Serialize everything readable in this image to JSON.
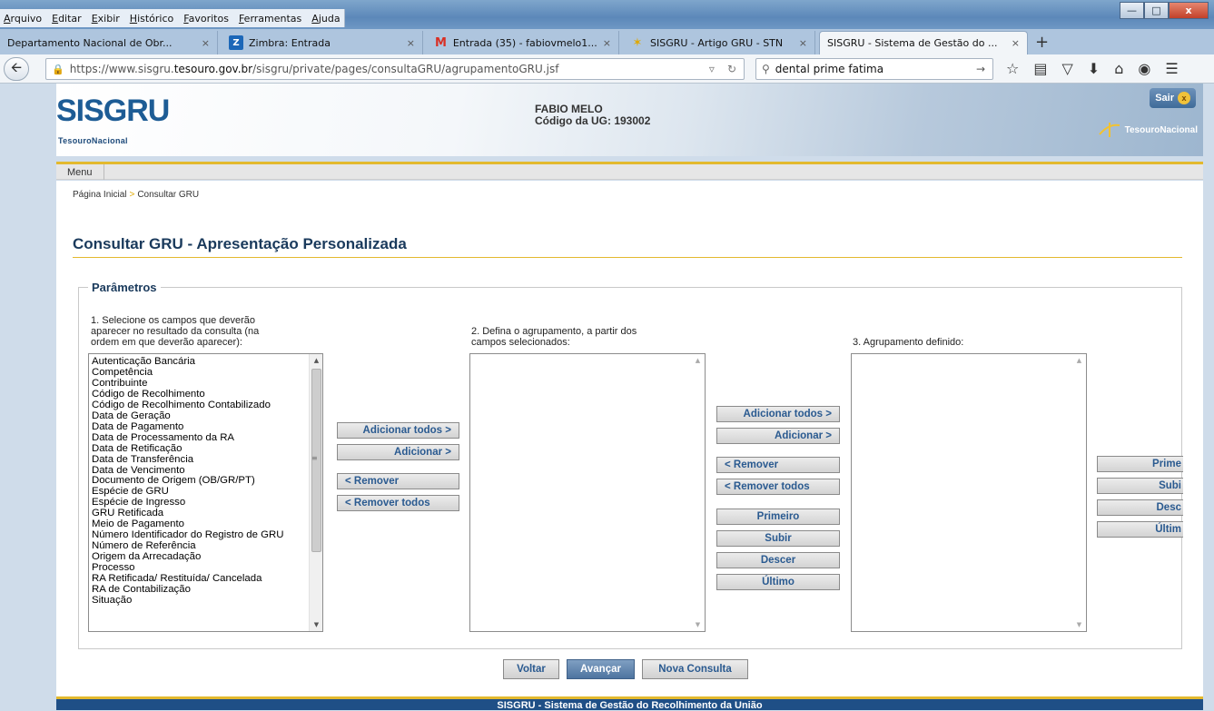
{
  "browser": {
    "menu": [
      "Arquivo",
      "Editar",
      "Exibir",
      "Histórico",
      "Favoritos",
      "Ferramentas",
      "Ajuda"
    ],
    "window_buttons": {
      "minimize": "—",
      "maximize": "□",
      "close": "x"
    },
    "tabs": [
      {
        "title": "Departamento Nacional de Obr...",
        "favicon": ""
      },
      {
        "title": "Zimbra: Entrada",
        "favicon": "Z"
      },
      {
        "title": "Entrada (35) - fabiovmelo1...",
        "favicon": "M"
      },
      {
        "title": "SISGRU - Artigo GRU - STN",
        "favicon": "✶"
      },
      {
        "title": "SISGRU - Sistema de Gestão do ...",
        "favicon": ""
      }
    ],
    "tab_close": "×",
    "new_tab": "+",
    "url_prefix": "https://www.sisgru.",
    "url_domain": "tesouro.gov.br",
    "url_path": "/sisgru/private/pages/consultaGRU/agrupamentoGRU.jsf",
    "search_value": "dental prime fatima"
  },
  "header": {
    "logo": "SISGRU",
    "logo_sub": "TesouroNacional",
    "user_name": "FABIO MELO",
    "ug_code": "Código da UG: 193002",
    "logout_label": "Sair",
    "brand_right": "TesouroNacional"
  },
  "nav": {
    "menu_label": "Menu",
    "breadcrumb_home": "Página Inicial",
    "breadcrumb_sep": ">",
    "breadcrumb_current": "Consultar GRU"
  },
  "page_title": "Consultar GRU - Apresentação Personalizada",
  "params": {
    "legend": "Parâmetros",
    "step1": [
      "1. Selecione os campos que deverão",
      "aparecer no resultado da consulta (na",
      "ordem em que deverão aparecer):"
    ],
    "step2": [
      "2. Defina o agrupamento, a partir dos",
      "campos selecionados:"
    ],
    "step3": "3. Agrupamento definido:",
    "fields": [
      "Autenticação Bancária",
      "Competência",
      "Contribuinte",
      "Código de Recolhimento",
      "Código de Recolhimento Contabilizado",
      "Data de Geração",
      "Data de Pagamento",
      "Data de Processamento da RA",
      "Data de Retificação",
      "Data de Transferência",
      "Data de Vencimento",
      "Documento de Origem (OB/GR/PT)",
      "Espécie de GRU",
      "Espécie de Ingresso",
      "GRU Retificada",
      "Meio de Pagamento",
      "Número Identificador do Registro de GRU",
      "Número de Referência",
      "Origem da Arrecadação",
      "Processo",
      "RA Retificada/ Restituída/ Cancelada",
      "RA de Contabilização",
      "Situação"
    ],
    "buttons_col1": {
      "add_all": "Adicionar todos >",
      "add": "Adicionar >",
      "remove": "< Remover",
      "remove_all": "< Remover todos"
    },
    "buttons_col2": {
      "add_all": "Adicionar todos >",
      "add": "Adicionar >",
      "remove": "< Remover",
      "remove_all": "< Remover todos",
      "first": "Primeiro",
      "up": "Subir",
      "down": "Descer",
      "last": "Último"
    },
    "buttons_col3": {
      "first": "Prime",
      "up": "Subi",
      "down": "Desc",
      "last": "Últim"
    }
  },
  "actions": {
    "back": "Voltar",
    "next": "Avançar",
    "new_query": "Nova Consulta"
  },
  "footer": "SISGRU - Sistema de Gestão do Recolhimento da União",
  "colors": {
    "brand_blue": "#1d5c95",
    "accent_gold": "#e3b92e",
    "button_text": "#2a5a90",
    "footer_bg": "#1f4f86"
  }
}
